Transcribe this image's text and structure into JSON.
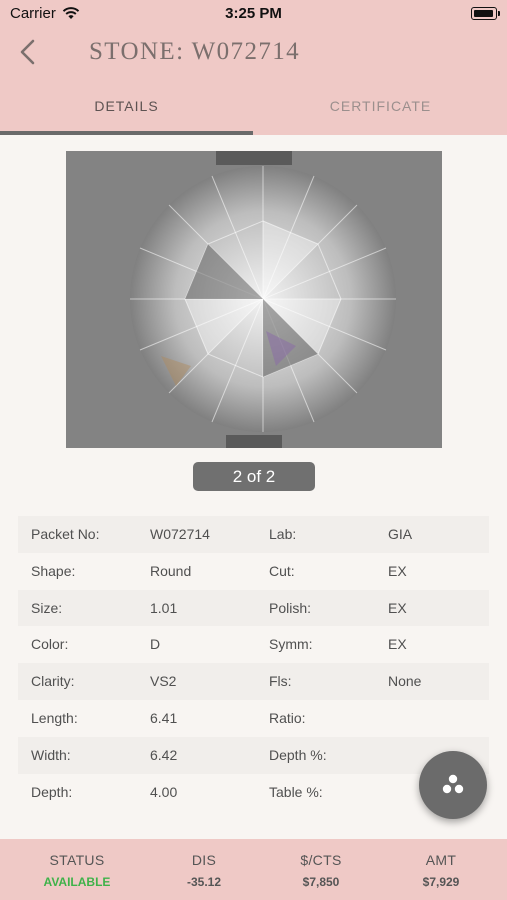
{
  "status_bar": {
    "carrier": "Carrier",
    "time": "3:25 PM"
  },
  "nav": {
    "title": "STONE: W072714"
  },
  "tabs": [
    {
      "label": "DETAILS",
      "active": true
    },
    {
      "label": "CERTIFICATE",
      "active": false
    }
  ],
  "gallery": {
    "page_indicator": "2 of 2"
  },
  "details": [
    {
      "l1": "Packet No:",
      "v1": "W072714",
      "l2": "Lab:",
      "v2": "GIA"
    },
    {
      "l1": "Shape:",
      "v1": "Round",
      "l2": "Cut:",
      "v2": "EX"
    },
    {
      "l1": "Size:",
      "v1": "1.01",
      "l2": "Polish:",
      "v2": "EX"
    },
    {
      "l1": "Color:",
      "v1": "D",
      "l2": "Symm:",
      "v2": "EX"
    },
    {
      "l1": "Clarity:",
      "v1": "VS2",
      "l2": "Fls:",
      "v2": "None"
    },
    {
      "l1": "Length:",
      "v1": "6.41",
      "l2": "Ratio:",
      "v2": ""
    },
    {
      "l1": "Width:",
      "v1": "6.42",
      "l2": "Depth %:",
      "v2": ""
    },
    {
      "l1": "Depth:",
      "v1": "4.00",
      "l2": "Table %:",
      "v2": ""
    }
  ],
  "footer": {
    "status_label": "STATUS",
    "status_value": "AVAILABLE",
    "dis_label": "DIS",
    "dis_value": "-35.12",
    "pcts_label": "$/CTS",
    "pcts_value": "$7,850",
    "amt_label": "AMT",
    "amt_value": "$7,929"
  },
  "colors": {
    "header_bg": "#efc9c6",
    "available": "#3fb24a",
    "fab": "#6b6b6b"
  },
  "icons": {
    "back": "chevron-left-icon",
    "fab": "three-dots-icon",
    "wifi": "wifi-icon",
    "battery": "battery-icon"
  }
}
